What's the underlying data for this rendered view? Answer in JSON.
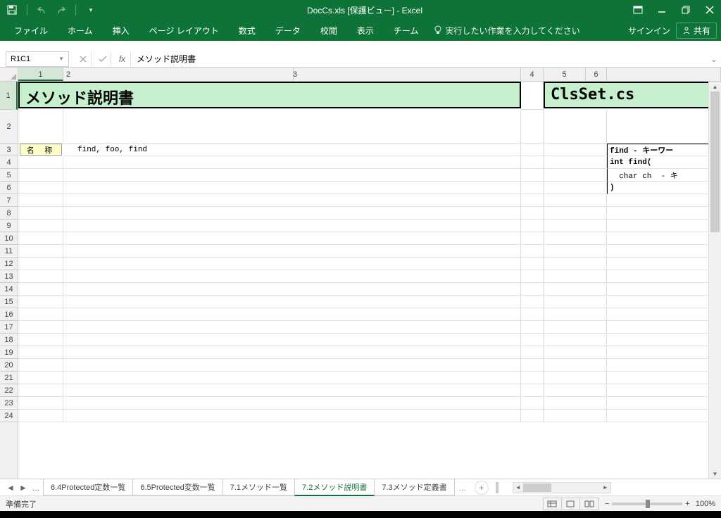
{
  "title": "DocCs.xls [保護ビュー] - Excel",
  "qat": {
    "undo": "↶",
    "redo": "↷"
  },
  "ribbon": {
    "tabs": [
      "ファイル",
      "ホーム",
      "挿入",
      "ページ レイアウト",
      "数式",
      "データ",
      "校閲",
      "表示",
      "チーム"
    ],
    "tellme": "実行したい作業を入力してください",
    "signin": "サインイン",
    "share": "共有"
  },
  "namebox": "R1C1",
  "formula": "メソッド説明書",
  "cols": [
    "1",
    "2",
    "3",
    "4",
    "5",
    "6"
  ],
  "cells": {
    "title1": "メソッド説明書",
    "title2": "ClsSet.cs",
    "label_name": "名 称",
    "c3_2": "find, foo, find",
    "r3_6": "find - キーワー",
    "r4_6": "int find(",
    "r5_6": "  char ch  - キ",
    "r6_6": ")"
  },
  "sheets": {
    "ellipsis": "...",
    "tabs": [
      "6.4Protected定数一覧",
      "6.5Protected変数一覧",
      "7.1メソッド一覧",
      "7.2メソッド説明書",
      "7.3メソッド定義書"
    ],
    "active_index": 3,
    "ellipsis2": "..."
  },
  "status": {
    "ready": "準備完了",
    "zoom": "100%"
  },
  "window": {
    "restore_small": "❐"
  }
}
